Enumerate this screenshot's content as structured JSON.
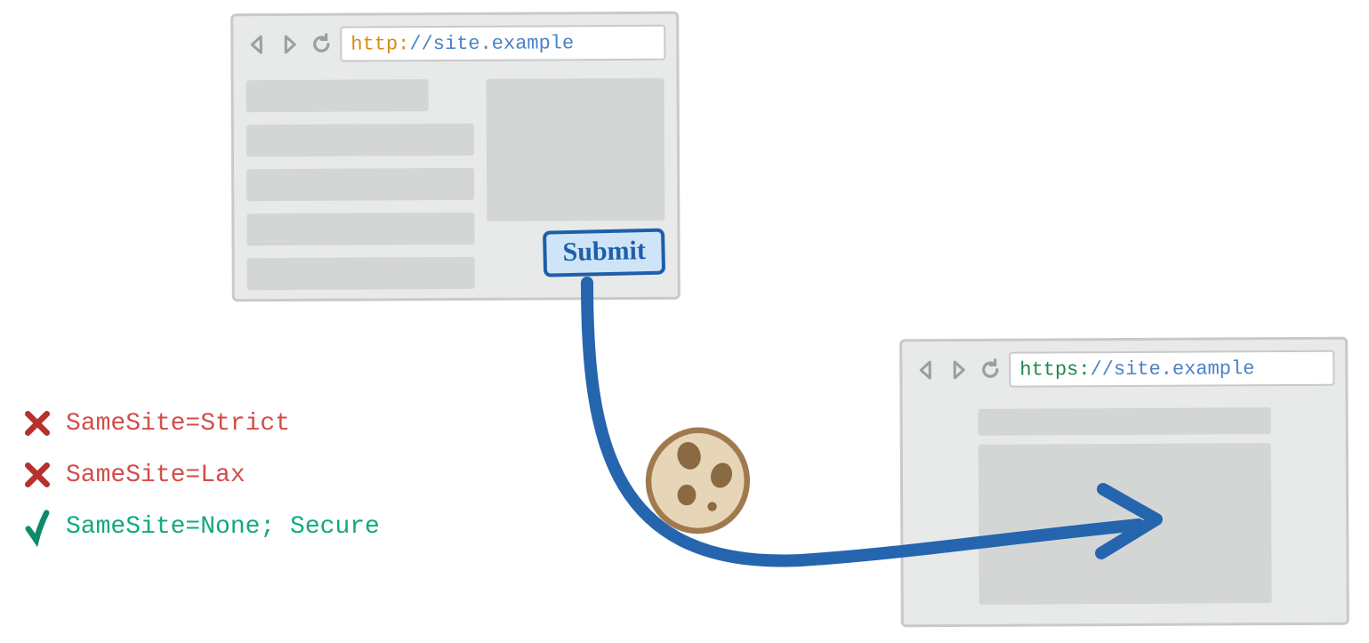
{
  "browser_top": {
    "url_scheme": "http:",
    "url_rest": "//site.example",
    "submit_label": "Submit"
  },
  "browser_bottom": {
    "url_scheme": "https:",
    "url_rest": "//site.example"
  },
  "legend": {
    "strict": "SameSite=Strict",
    "lax": "SameSite=Lax",
    "none": "SameSite=None; Secure"
  },
  "icons": {
    "cookie": "cookie-icon",
    "back": "back-icon",
    "forward": "forward-icon",
    "reload": "reload-icon",
    "cross": "cross-icon",
    "check": "check-icon"
  }
}
